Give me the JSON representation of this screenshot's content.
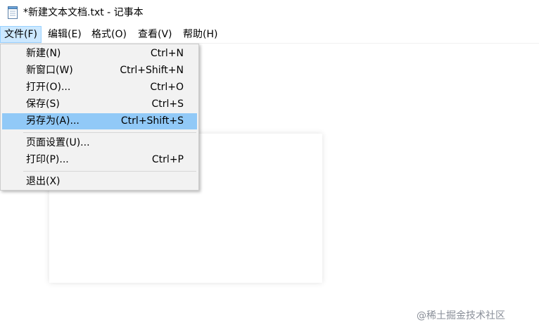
{
  "window": {
    "title": "*新建文本文档.txt - 记事本",
    "icon": "notepad-icon"
  },
  "menubar": {
    "items": [
      {
        "label": "文件(F)",
        "active": true
      },
      {
        "label": "编辑(E)",
        "active": false
      },
      {
        "label": "格式(O)",
        "active": false
      },
      {
        "label": "查看(V)",
        "active": false
      },
      {
        "label": "帮助(H)",
        "active": false
      }
    ]
  },
  "file_menu": {
    "items": [
      {
        "label": "新建(N)",
        "shortcut": "Ctrl+N"
      },
      {
        "label": "新窗口(W)",
        "shortcut": "Ctrl+Shift+N"
      },
      {
        "label": "打开(O)...",
        "shortcut": "Ctrl+O"
      },
      {
        "label": "保存(S)",
        "shortcut": "Ctrl+S"
      },
      {
        "label": "另存为(A)...",
        "shortcut": "Ctrl+Shift+S",
        "highlighted": true
      },
      {
        "label": "页面设置(U)...",
        "shortcut": ""
      },
      {
        "label": "打印(P)...",
        "shortcut": "Ctrl+P"
      },
      {
        "label": "退出(X)",
        "shortcut": ""
      }
    ]
  },
  "watermark": {
    "text": "@稀土掘金技术社区"
  },
  "colors": {
    "menu_active_bg": "#cce8ff",
    "menu_item_highlight": "#91c9f7",
    "dropdown_bg": "#f2f2f2"
  }
}
